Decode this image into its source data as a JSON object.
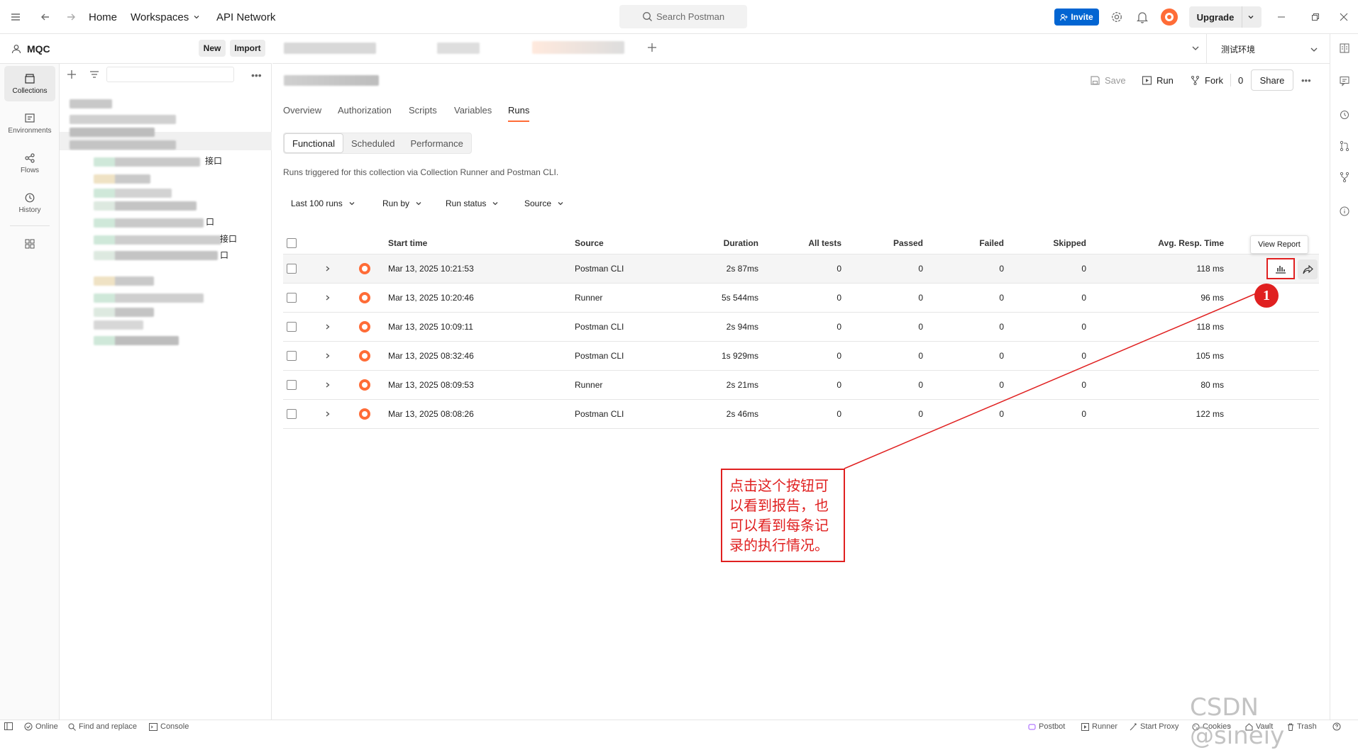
{
  "topbar": {
    "nav": {
      "home": "Home",
      "workspaces": "Workspaces",
      "api_network": "API Network"
    },
    "search_placeholder": "Search Postman",
    "invite": "Invite",
    "upgrade": "Upgrade"
  },
  "workspace": {
    "name": "MQC",
    "new_label": "New",
    "import_label": "Import"
  },
  "rail": [
    {
      "label": "Collections",
      "icon": "collections-icon"
    },
    {
      "label": "Environments",
      "icon": "environments-icon"
    },
    {
      "label": "Flows",
      "icon": "flows-icon"
    },
    {
      "label": "History",
      "icon": "history-icon"
    }
  ],
  "sidebar_fragments": {
    "f1": "接口",
    "f2": "口",
    "f3": "接口",
    "f4": "口"
  },
  "environment": "测试环境",
  "actions": {
    "save": "Save",
    "run": "Run",
    "fork": "Fork",
    "fork_count": "0",
    "share": "Share"
  },
  "subtabs": [
    "Overview",
    "Authorization",
    "Scripts",
    "Variables",
    "Runs"
  ],
  "segments": [
    "Functional",
    "Scheduled",
    "Performance"
  ],
  "description": "Runs triggered for this collection via Collection Runner and Postman CLI.",
  "filters": {
    "range": "Last 100 runs",
    "run_by": "Run by",
    "run_status": "Run status",
    "source": "Source"
  },
  "table": {
    "headers": {
      "start": "Start time",
      "source": "Source",
      "duration": "Duration",
      "all": "All tests",
      "passed": "Passed",
      "failed": "Failed",
      "skipped": "Skipped",
      "avg": "Avg. Resp. Time"
    },
    "rows": [
      {
        "start": "Mar 13, 2025 10:21:53",
        "source": "Postman CLI",
        "duration": "2s 87ms",
        "all": "0",
        "passed": "0",
        "failed": "0",
        "skipped": "0",
        "avg": "118 ms"
      },
      {
        "start": "Mar 13, 2025 10:20:46",
        "source": "Runner",
        "duration": "5s 544ms",
        "all": "0",
        "passed": "0",
        "failed": "0",
        "skipped": "0",
        "avg": "96 ms"
      },
      {
        "start": "Mar 13, 2025 10:09:11",
        "source": "Postman CLI",
        "duration": "2s 94ms",
        "all": "0",
        "passed": "0",
        "failed": "0",
        "skipped": "0",
        "avg": "118 ms"
      },
      {
        "start": "Mar 13, 2025 08:32:46",
        "source": "Postman CLI",
        "duration": "1s 929ms",
        "all": "0",
        "passed": "0",
        "failed": "0",
        "skipped": "0",
        "avg": "105 ms"
      },
      {
        "start": "Mar 13, 2025 08:09:53",
        "source": "Runner",
        "duration": "2s 21ms",
        "all": "0",
        "passed": "0",
        "failed": "0",
        "skipped": "0",
        "avg": "80 ms"
      },
      {
        "start": "Mar 13, 2025 08:08:26",
        "source": "Postman CLI",
        "duration": "2s 46ms",
        "all": "0",
        "passed": "0",
        "failed": "0",
        "skipped": "0",
        "avg": "122 ms"
      }
    ]
  },
  "tooltip": "View Report",
  "annotation": {
    "badge": "1",
    "lines": [
      "点击这个按钮可",
      "以看到报告，也",
      "可以看到每条记",
      "录的执行情况。"
    ],
    "color": "#e02020"
  },
  "statusbar": {
    "online": "Online",
    "find": "Find and replace",
    "console": "Console",
    "postbot": "Postbot",
    "runner": "Runner",
    "proxy": "Start Proxy",
    "cookies": "Cookies",
    "vault": "Vault",
    "trash": "Trash"
  },
  "watermark": "CSDN @sineiy",
  "colors": {
    "accent": "#ff6c37",
    "invite": "#0265d2"
  }
}
